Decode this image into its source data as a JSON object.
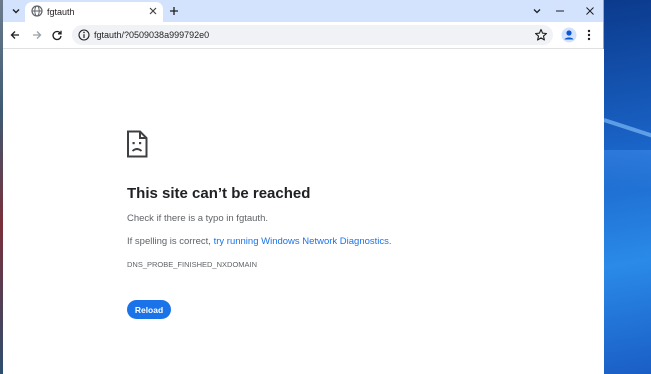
{
  "tab": {
    "title": "fgtauth",
    "close_glyph": "✕",
    "new_tab_glyph": "+",
    "menu_glyph": "⌄"
  },
  "window_controls": {
    "chevron": "⌄",
    "minimize": "—",
    "maximize": "☐",
    "close": "✕"
  },
  "toolbar": {
    "url": "fgtauth/?0509038a999792e0"
  },
  "error_page": {
    "heading": "This site can’t be reached",
    "typo_hint": "Check if there is a typo in fgtauth.",
    "spelling_prefix": "If spelling is correct, ",
    "diagnostics_link": "try running Windows Network Diagnostics",
    "spelling_suffix": ".",
    "error_code": "DNS_PROBE_FINISHED_NXDOMAIN",
    "reload_label": "Reload"
  },
  "colors": {
    "accent": "#1a73e8",
    "tabstrip": "#d3e3fd",
    "heading": "#202124",
    "body_text": "#5f6368"
  },
  "icons": [
    "tab-search-icon",
    "globe-icon",
    "close-icon",
    "plus-icon",
    "back-arrow-icon",
    "forward-arrow-icon",
    "reload-icon",
    "info-icon",
    "star-icon",
    "profile-icon",
    "kebab-menu-icon",
    "sad-page-icon"
  ]
}
